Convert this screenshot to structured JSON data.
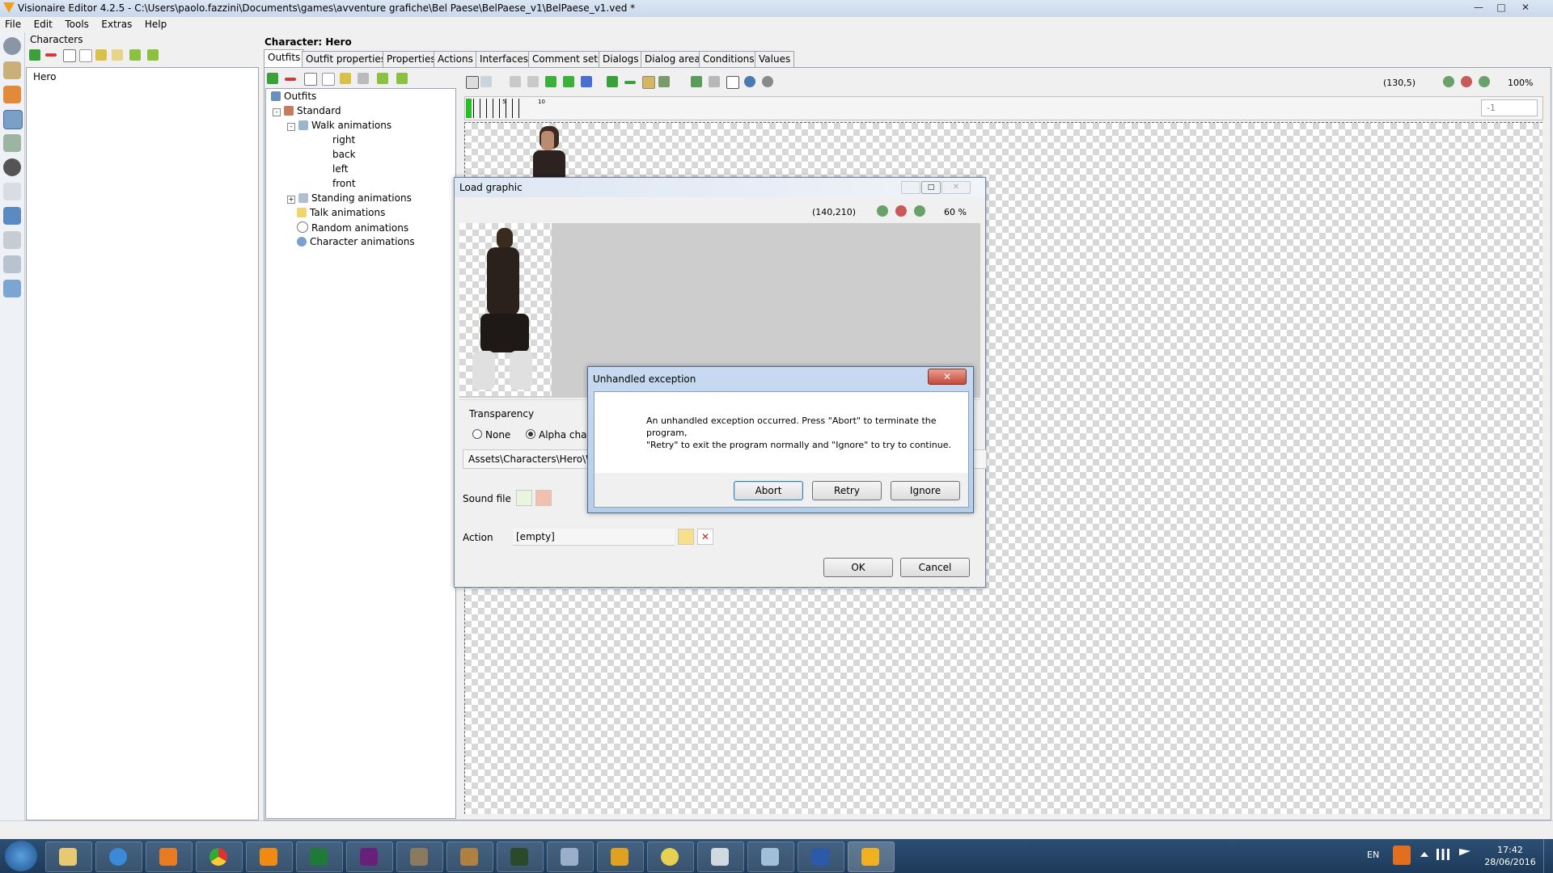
{
  "window": {
    "title": "Visionaire Editor 4.2.5 - C:\\Users\\paolo.fazzini\\Documents\\games\\avventure grafiche\\Bel Paese\\BelPaese_v1\\BelPaese_v1.ved *",
    "controls": [
      "minimize",
      "maximize",
      "close"
    ]
  },
  "menu": [
    "File",
    "Edit",
    "Tools",
    "Extras",
    "Help"
  ],
  "left_strip_icons": [
    "settings-icon",
    "hourglass-icon",
    "home-icon",
    "character-icon",
    "gamepad-icon",
    "ball-icon",
    "cursor-icon",
    "text-icon",
    "document-icon",
    "cloud-icon",
    "script-icon"
  ],
  "characters_panel": {
    "title": "Characters",
    "items": [
      "Hero"
    ]
  },
  "character_header": "Character: Hero",
  "tabs": [
    "Outfits",
    "Outfit properties",
    "Properties",
    "Actions",
    "Interfaces",
    "Comment sets",
    "Dialogs",
    "Dialog area",
    "Conditions",
    "Values"
  ],
  "tree": {
    "root": "Outfits",
    "outfit": "Standard",
    "walk": "Walk animations",
    "walk_children": [
      "right",
      "back",
      "left",
      "front"
    ],
    "others": [
      "Standing animations",
      "Talk animations",
      "Random animations",
      "Character animations"
    ]
  },
  "canvas": {
    "coords": "(130,5)",
    "zoom": "100%",
    "frame_field": "-1",
    "timeline_labels": [
      "5",
      "10"
    ]
  },
  "load_graphic": {
    "title": "Load graphic",
    "coords": "(140,210)",
    "zoom": "60 %",
    "transparency_label": "Transparency",
    "radio_none": "None",
    "radio_alpha": "Alpha chann",
    "path": "Assets\\Characters\\Hero\\Wa",
    "sound_label": "Sound file",
    "action_label": "Action",
    "action_value": "[empty]",
    "ok": "OK",
    "cancel": "Cancel"
  },
  "error_dialog": {
    "title": "Unhandled exception",
    "line1": "An unhandled exception occurred. Press \"Abort\" to terminate the",
    "line2": "program,",
    "line3": "\"Retry\" to exit the program normally and \"Ignore\" to try to continue.",
    "abort": "Abort",
    "retry": "Retry",
    "ignore": "Ignore"
  },
  "taskbar": {
    "apps": [
      "windows-start",
      "file-explorer",
      "internet-explorer",
      "media-player",
      "chrome",
      "vlc",
      "excel",
      "visual-studio",
      "gimp",
      "joystick",
      "terminal",
      "calculator",
      "outlook",
      "paint",
      "notepad",
      "word-pad",
      "word",
      "visionaire"
    ],
    "lang": "EN",
    "time": "17:42",
    "date": "28/06/2016"
  }
}
